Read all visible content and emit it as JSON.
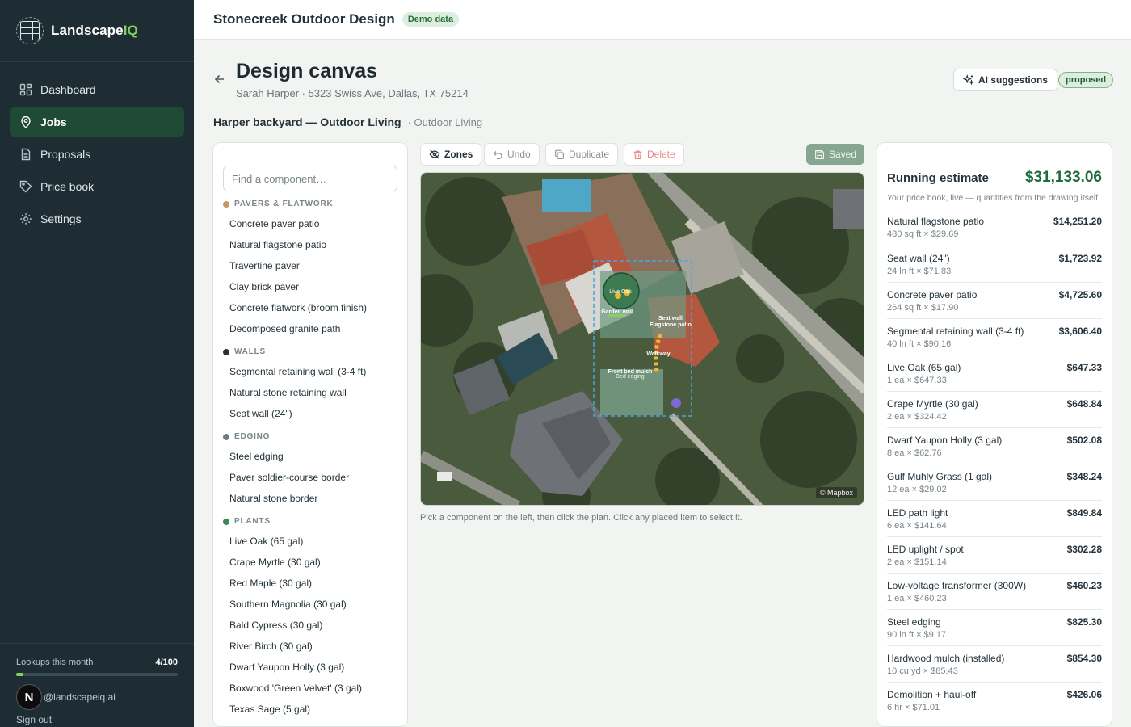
{
  "brand": {
    "name_main": "Landscape",
    "name_accent": "IQ"
  },
  "nav": [
    {
      "label": "Dashboard",
      "icon": "dashboard-icon"
    },
    {
      "label": "Jobs",
      "icon": "jobs-icon",
      "active": true
    },
    {
      "label": "Proposals",
      "icon": "proposals-icon"
    },
    {
      "label": "Price book",
      "icon": "price-tag-icon"
    },
    {
      "label": "Settings",
      "icon": "gear-icon"
    }
  ],
  "footer": {
    "lookups_label": "Lookups this month",
    "lookups_count": "4/100",
    "lookups_fraction": 0.04,
    "avatar_letter": "N",
    "email": "@landscapeiq.ai",
    "signout": "Sign out"
  },
  "topbar": {
    "company": "Stonecreek Outdoor Design",
    "badge": "Demo data"
  },
  "header": {
    "title": "Design canvas",
    "subtitle": "Sarah Harper · 5323 Swiss Ave, Dallas, TX 75214",
    "ai_button": "AI suggestions",
    "status": "proposed",
    "project_name": "Harper backyard — Outdoor Living",
    "project_type": "· Outdoor Living"
  },
  "library": {
    "search_placeholder": "Find a component…",
    "categories": [
      {
        "name": "PAVERS & FLATWORK",
        "color": "#c29a62",
        "items": [
          "Concrete paver patio",
          "Natural flagstone patio",
          "Travertine paver",
          "Clay brick paver",
          "Concrete flatwork (broom finish)",
          "Decomposed granite path"
        ]
      },
      {
        "name": "WALLS",
        "color": "#2b2f33",
        "items": [
          "Segmental retaining wall (3-4 ft)",
          "Natural stone retaining wall",
          "Seat wall (24\")"
        ]
      },
      {
        "name": "EDGING",
        "color": "#6e7c84",
        "items": [
          "Steel edging",
          "Paver soldier-course border",
          "Natural stone border"
        ]
      },
      {
        "name": "PLANTS",
        "color": "#3a8a57",
        "items": [
          "Live Oak (65 gal)",
          "Crape Myrtle (30 gal)",
          "Red Maple (30 gal)",
          "Southern Magnolia (30 gal)",
          "Bald Cypress (30 gal)",
          "River Birch (30 gal)",
          "Dwarf Yaupon Holly (3 gal)",
          "Boxwood 'Green Velvet' (3 gal)",
          "Texas Sage (5 gal)"
        ]
      }
    ]
  },
  "toolbar": {
    "zones": "Zones",
    "undo": "Undo",
    "duplicate": "Duplicate",
    "delete": "Delete",
    "saved": "Saved"
  },
  "map": {
    "attribution": "© Mapbox",
    "labels": {
      "live_oak": "Live Oak",
      "garden_wall": "Garden wall",
      "seat_wall": "Seat wall",
      "flagstone_patio": "Flagstone patio",
      "walkway": "Walkway",
      "front_bed_mulch": "Front bed mulch",
      "bed_edging": "Bed edging"
    }
  },
  "hint": "Pick a component on the left, then click the plan. Click any placed item to select it.",
  "estimate": {
    "title": "Running estimate",
    "total": "$31,133.06",
    "note": "Your price book, live — quantities from the drawing itself.",
    "items": [
      {
        "name": "Natural flagstone patio",
        "qty": "480 sq ft × $29.69",
        "price": "$14,251.20"
      },
      {
        "name": "Seat wall (24\")",
        "qty": "24 ln ft × $71.83",
        "price": "$1,723.92"
      },
      {
        "name": "Concrete paver patio",
        "qty": "264 sq ft × $17.90",
        "price": "$4,725.60"
      },
      {
        "name": "Segmental retaining wall (3-4 ft)",
        "qty": "40 ln ft × $90.16",
        "price": "$3,606.40"
      },
      {
        "name": "Live Oak (65 gal)",
        "qty": "1 ea × $647.33",
        "price": "$647.33"
      },
      {
        "name": "Crape Myrtle (30 gal)",
        "qty": "2 ea × $324.42",
        "price": "$648.84"
      },
      {
        "name": "Dwarf Yaupon Holly (3 gal)",
        "qty": "8 ea × $62.76",
        "price": "$502.08"
      },
      {
        "name": "Gulf Muhly Grass (1 gal)",
        "qty": "12 ea × $29.02",
        "price": "$348.24"
      },
      {
        "name": "LED path light",
        "qty": "6 ea × $141.64",
        "price": "$849.84"
      },
      {
        "name": "LED uplight / spot",
        "qty": "2 ea × $151.14",
        "price": "$302.28"
      },
      {
        "name": "Low-voltage transformer (300W)",
        "qty": "1 ea × $460.23",
        "price": "$460.23"
      },
      {
        "name": "Steel edging",
        "qty": "90 ln ft × $9.17",
        "price": "$825.30"
      },
      {
        "name": "Hardwood mulch (installed)",
        "qty": "10 cu yd × $85.43",
        "price": "$854.30"
      },
      {
        "name": "Demolition + haul-off",
        "qty": "6 hr × $71.01",
        "price": "$426.06"
      }
    ]
  }
}
